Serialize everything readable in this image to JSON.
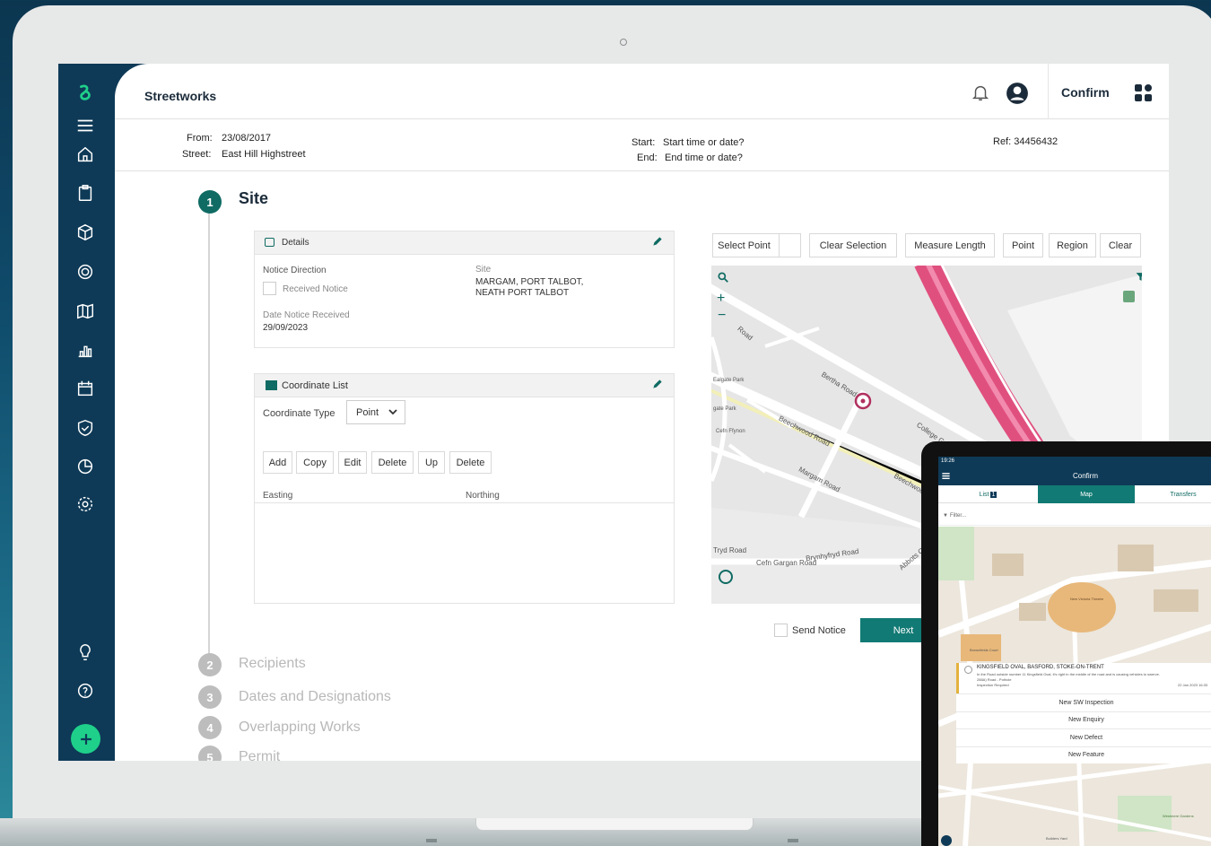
{
  "app": {
    "title": "Streetworks",
    "confirm_label": "Confirm"
  },
  "sidebar": {
    "icons": [
      "logo-icon",
      "menu-icon",
      "home-icon",
      "clipboard-icon",
      "box-icon",
      "target-icon",
      "map-icon",
      "chart-icon",
      "calendar-icon",
      "shield-icon",
      "pie-icon",
      "settings-icon",
      "bulb-icon",
      "help-icon",
      "add-icon"
    ]
  },
  "info": {
    "from_label": "From:",
    "from_value": "23/08/2017",
    "street_label": "Street:",
    "street_value": "East Hill Highstreet",
    "start_label": "Start:",
    "start_value": "Start time or date?",
    "end_label": "End:",
    "end_value": "End time or date?",
    "ref": "Ref: 34456432"
  },
  "steps": [
    {
      "num": "1",
      "label": "Site"
    },
    {
      "num": "2",
      "label": "Recipients"
    },
    {
      "num": "3",
      "label": "Dates and Designations"
    },
    {
      "num": "4",
      "label": "Overlapping Works"
    },
    {
      "num": "5",
      "label": "Permit"
    }
  ],
  "details": {
    "title": "Details",
    "notice_direction_label": "Notice Direction",
    "received_notice_label": "Received Notice",
    "date_notice_label": "Date Notice Received",
    "date_notice_value": "29/09/2023",
    "site_label": "Site",
    "site_line1": "MARGAM, PORT TALBOT,",
    "site_line2": "NEATH PORT TALBOT"
  },
  "coords": {
    "title": "Coordinate List",
    "type_label": "Coordinate Type",
    "type_value": "Point",
    "buttons": [
      "Add",
      "Copy",
      "Edit",
      "Delete",
      "Up",
      "Delete"
    ],
    "col_easting": "Easting",
    "col_northing": "Northing"
  },
  "map_toolbar": [
    "Select Point",
    "Clear Selection",
    "Measure Length",
    "Point",
    "Region",
    "Clear"
  ],
  "map_labels": {
    "road1": "Bertha Road",
    "road2": "Beechwood Road",
    "road3": "College Green",
    "road4": "Margam Road",
    "road5": "Beechwood Road",
    "road6": "Brynhyfryd Road",
    "road7": "Cefn Gargan Road",
    "road8": "Abbots Close",
    "road9": "Cefn Ffynon",
    "road10": "Tryd Road",
    "road11": "Road",
    "road12": "Ealgate Park",
    "road13": "gate Park"
  },
  "actions": {
    "send_notice": "Send Notice",
    "next": "Next"
  },
  "tablet": {
    "status_time": "19:26",
    "header": "Confirm",
    "tabs": [
      "List",
      "Map",
      "Transfers"
    ],
    "list_badge": "1",
    "filter_placeholder": "Filter...",
    "card_title": "KINGSFIELD OVAL, BASFORD, STOKE-ON-TRENT",
    "card_line1": "In the Road outside number 11 Kingsfield Oval, it's right in the middle of the road and is causing vehicles to swerve.",
    "card_line2": "288A) Road - Pothole",
    "card_line3": "Inspection Required",
    "card_date": "22 Jan 2023 16:33",
    "menu": [
      "New SW Inspection",
      "New Enquiry",
      "New Defect",
      "New Feature"
    ],
    "map_labels": [
      "New Victoria Theatre",
      "Brownfields Court",
      "Builders Yard",
      "Westmere Gardens"
    ]
  },
  "colors": {
    "sidebar": "#0e3a57",
    "accent": "#0f6b63",
    "next_button": "#127a74",
    "highlight_road": "#e5538a"
  }
}
